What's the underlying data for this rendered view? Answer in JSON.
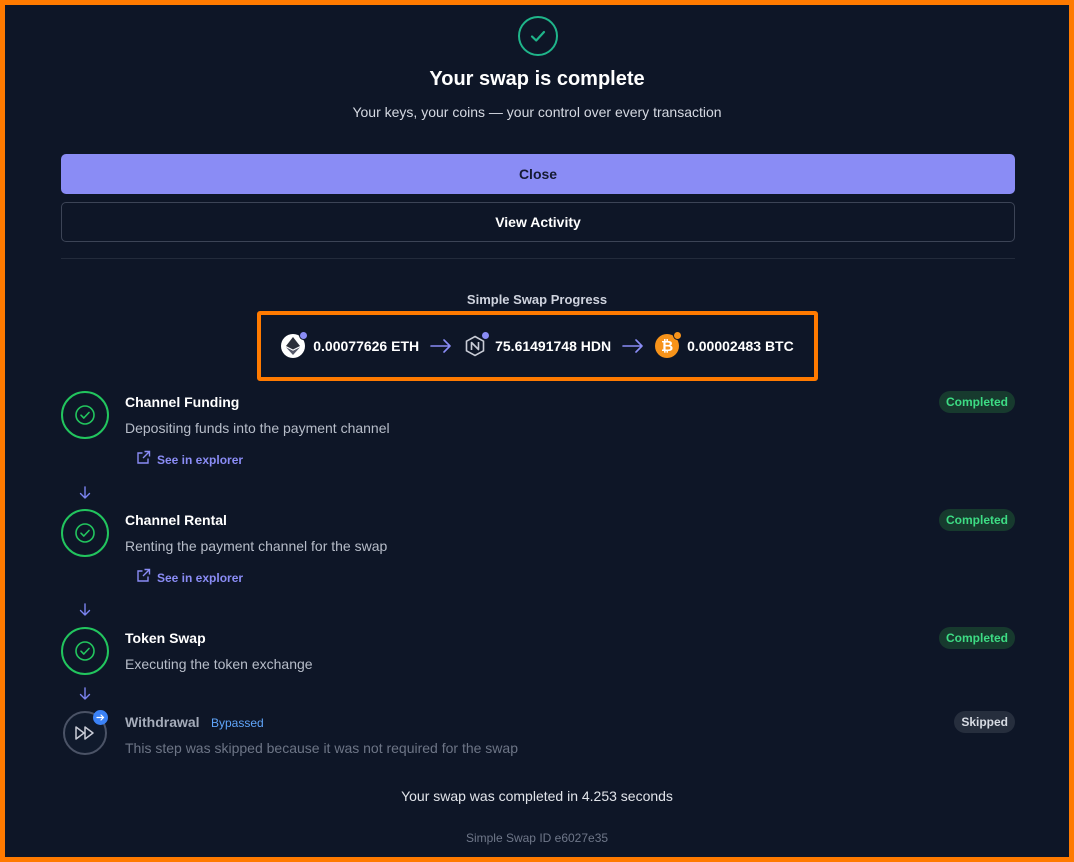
{
  "header": {
    "title": "Your swap is complete",
    "subtitle": "Your keys, your coins — your control over every transaction"
  },
  "actions": {
    "close_label": "Close",
    "view_activity_label": "View Activity"
  },
  "progress": {
    "title": "Simple Swap Progress",
    "from": {
      "amount": "0.00077626 ETH",
      "icon": "ethereum-icon"
    },
    "via": {
      "amount": "75.61491748 HDN",
      "icon": "hydranet-icon"
    },
    "to": {
      "amount": "0.00002483 BTC",
      "icon": "bitcoin-icon"
    },
    "colors": {
      "accent": "#8a8cf5",
      "success": "#22c55e",
      "bitcoin": "#f7931a",
      "highlight": "#ff7a00"
    }
  },
  "steps": [
    {
      "name": "Channel Funding",
      "description": "Depositing funds into the payment channel",
      "status": "Completed",
      "link": "See in explorer"
    },
    {
      "name": "Channel Rental",
      "description": "Renting the payment channel for the swap",
      "status": "Completed",
      "link": "See in explorer"
    },
    {
      "name": "Token Swap",
      "description": "Executing the token exchange",
      "status": "Completed"
    },
    {
      "name": "Withdrawal",
      "tag": "Bypassed",
      "description": "This step was skipped because it was not required for the swap",
      "status": "Skipped"
    }
  ],
  "footer": {
    "completion": "Your swap was completed in 4.253 seconds",
    "swap_id": "Simple Swap ID e6027e35"
  }
}
